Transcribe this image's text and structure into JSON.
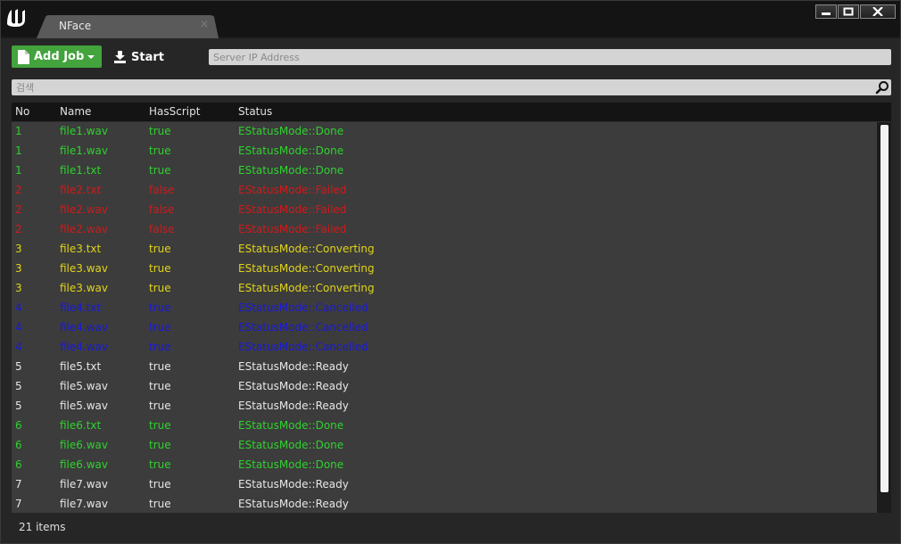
{
  "window": {
    "tab_title": "NFace",
    "tab_close": "×"
  },
  "toolbar": {
    "add_job_label": "Add Job",
    "start_label": "Start",
    "server_ip_placeholder": "Server IP Address"
  },
  "search": {
    "placeholder": "검색"
  },
  "table": {
    "columns": [
      "No",
      "Name",
      "HasScript",
      "Status"
    ],
    "rows": [
      {
        "no": "1",
        "name": "file1.wav",
        "has_script": "true",
        "status": "EStatusMode::Done"
      },
      {
        "no": "1",
        "name": "file1.wav",
        "has_script": "true",
        "status": "EStatusMode::Done"
      },
      {
        "no": "1",
        "name": "file1.txt",
        "has_script": "true",
        "status": "EStatusMode::Done"
      },
      {
        "no": "2",
        "name": "file2.txt",
        "has_script": "false",
        "status": "EStatusMode::Failed"
      },
      {
        "no": "2",
        "name": "file2.wav",
        "has_script": "false",
        "status": "EStatusMode::Failed"
      },
      {
        "no": "2",
        "name": "file2.wav",
        "has_script": "false",
        "status": "EStatusMode::Failed"
      },
      {
        "no": "3",
        "name": "file3.txt",
        "has_script": "true",
        "status": "EStatusMode::Converting"
      },
      {
        "no": "3",
        "name": "file3.wav",
        "has_script": "true",
        "status": "EStatusMode::Converting"
      },
      {
        "no": "3",
        "name": "file3.wav",
        "has_script": "true",
        "status": "EStatusMode::Converting"
      },
      {
        "no": "4",
        "name": "file4.txt",
        "has_script": "true",
        "status": "EStatusMode::Cancelled"
      },
      {
        "no": "4",
        "name": "file4.wav",
        "has_script": "true",
        "status": "EStatusMode::Cancelled"
      },
      {
        "no": "4",
        "name": "file4.wav",
        "has_script": "true",
        "status": "EStatusMode::Cancelled"
      },
      {
        "no": "5",
        "name": "file5.txt",
        "has_script": "true",
        "status": "EStatusMode::Ready"
      },
      {
        "no": "5",
        "name": "file5.wav",
        "has_script": "true",
        "status": "EStatusMode::Ready"
      },
      {
        "no": "5",
        "name": "file5.wav",
        "has_script": "true",
        "status": "EStatusMode::Ready"
      },
      {
        "no": "6",
        "name": "file6.txt",
        "has_script": "true",
        "status": "EStatusMode::Done"
      },
      {
        "no": "6",
        "name": "file6.wav",
        "has_script": "true",
        "status": "EStatusMode::Done"
      },
      {
        "no": "6",
        "name": "file6.wav",
        "has_script": "true",
        "status": "EStatusMode::Done"
      },
      {
        "no": "7",
        "name": "file7.wav",
        "has_script": "true",
        "status": "EStatusMode::Ready"
      },
      {
        "no": "7",
        "name": "file7.wav",
        "has_script": "true",
        "status": "EStatusMode::Ready"
      }
    ]
  },
  "status_colors": {
    "EStatusMode::Done": "#2fd12f",
    "EStatusMode::Failed": "#d11a1a",
    "EStatusMode::Converting": "#e0d41a",
    "EStatusMode::Cancelled": "#1a1ad6",
    "EStatusMode::Ready": "#e6e6e6"
  },
  "colors": {
    "add_job_green": "#43a33d",
    "panel_bg": "#262626",
    "table_bg": "#3c3c3c"
  },
  "icons": {
    "logo": "unreal-engine-logo",
    "add_job": "document-icon",
    "start": "download-icon",
    "search": "magnifier-icon"
  },
  "footer": {
    "item_count": "21 items"
  }
}
